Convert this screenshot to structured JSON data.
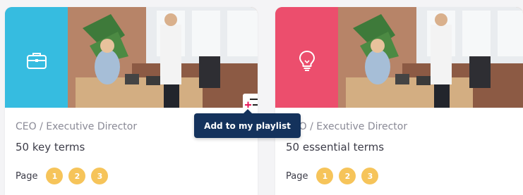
{
  "colors": {
    "card1_accent": "#2cc1ea",
    "card2_accent": "#f04a6e",
    "page_dot": "#f6c45a",
    "tooltip_bg": "#14325c"
  },
  "cards": [
    {
      "icon": "briefcase-icon",
      "role": "CEO / Executive Director",
      "terms": "50 key terms",
      "page_label": "Page",
      "pages": [
        "1",
        "2",
        "3"
      ]
    },
    {
      "icon": "lightbulb-icon",
      "role": "CEO / Executive Director",
      "terms": "50 essential terms",
      "page_label": "Page",
      "pages": [
        "1",
        "2",
        "3"
      ]
    }
  ],
  "playlist_button": {
    "icon": "add-to-playlist-icon"
  },
  "tooltip": {
    "label": "Add to my playlist"
  }
}
